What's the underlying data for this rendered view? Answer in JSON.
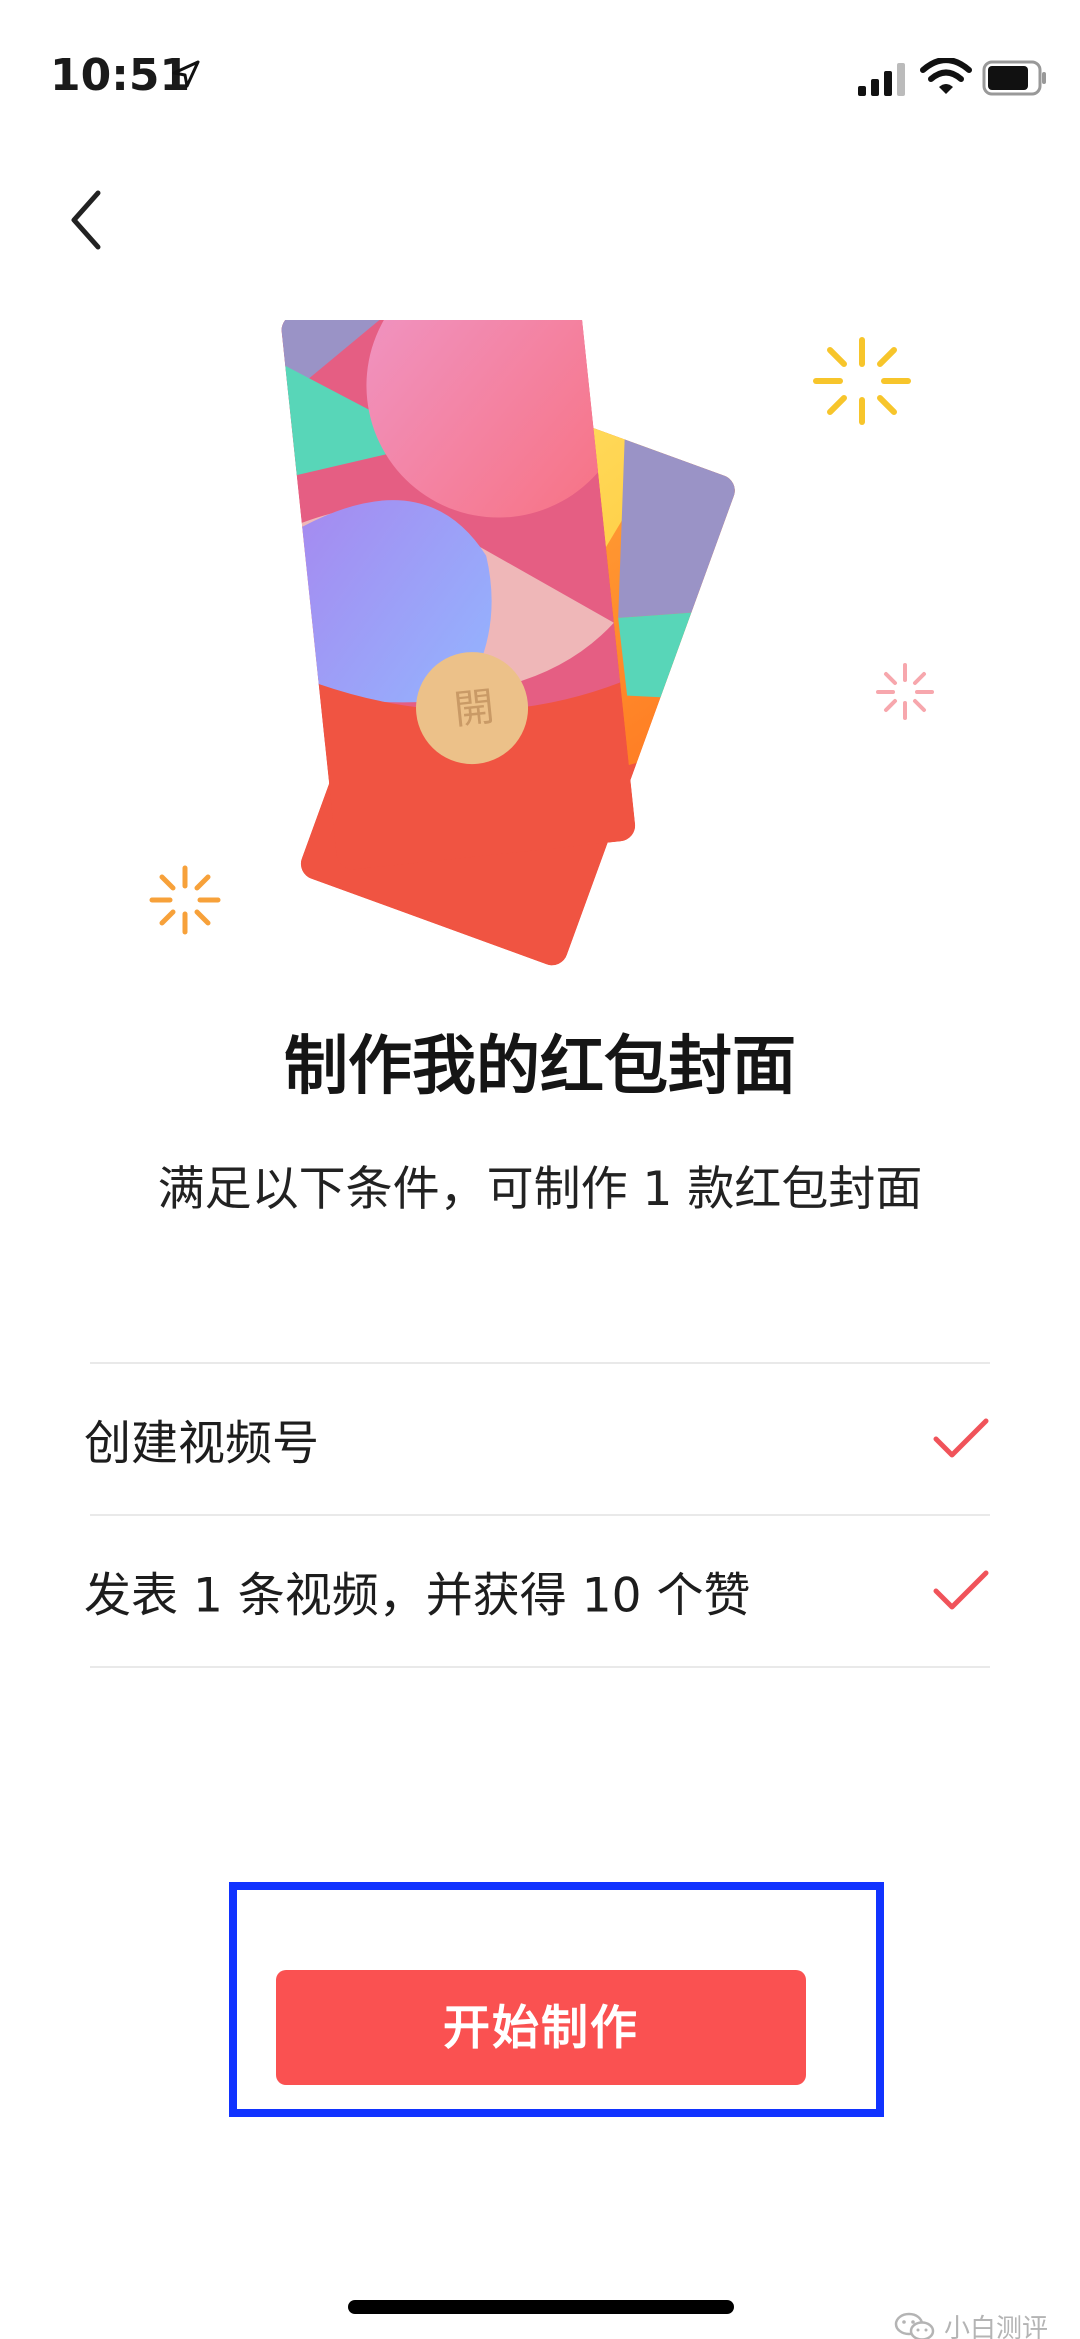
{
  "status_bar": {
    "time": "10:51"
  },
  "nav": {
    "back_icon": "chevron-left-icon"
  },
  "illustration": {
    "seal_text": "開"
  },
  "page": {
    "title": "制作我的红包封面",
    "subtitle": "满足以下条件，可制作 1 款红包封面"
  },
  "conditions": [
    {
      "label": "创建视频号",
      "status": "done",
      "icon": "check-icon"
    },
    {
      "label": "发表 1 条视频，并获得 10 个赞",
      "status": "done",
      "icon": "check-icon"
    }
  ],
  "actions": {
    "start_label": "开始制作"
  },
  "watermark": {
    "text": "小白测评",
    "icon": "wechat-icon"
  },
  "colors": {
    "accent": "#fa5151",
    "check": "#f0535a",
    "highlight_border": "#1133ff"
  }
}
